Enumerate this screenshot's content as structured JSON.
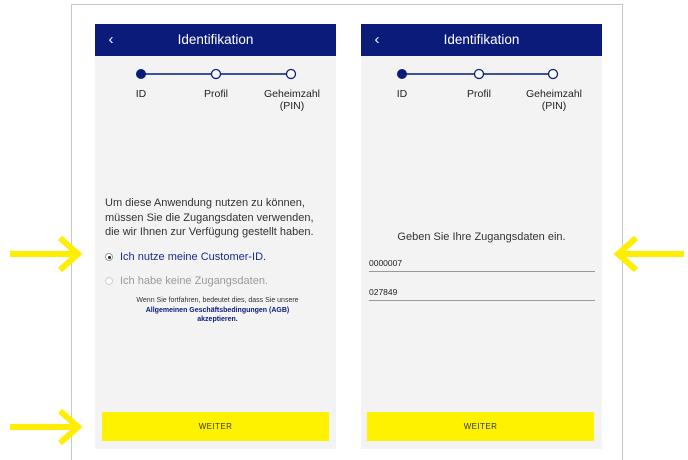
{
  "colors": {
    "nav_bg": "#0b1b7a",
    "screen_bg": "#f3f3f3",
    "cta_bg": "#fff200",
    "arrow": "#ffee00",
    "link": "#0b1b7a"
  },
  "left_screen": {
    "nav": {
      "back_glyph": "‹",
      "title": "Identifikation"
    },
    "stepper": {
      "steps": [
        {
          "label": "ID",
          "state": "active"
        },
        {
          "label": "Profil",
          "state": "pending"
        },
        {
          "label_line1": "Geheimzahl",
          "label_line2": "(PIN)",
          "state": "pending"
        }
      ]
    },
    "intro_text": "Um diese Anwendung nutzen zu können, müssen Sie die Zugangsdaten verwenden, die wir Ihnen zur Verfügung gestellt haben.",
    "options": [
      {
        "label": "Ich nutze meine Customer-ID.",
        "selected": true
      },
      {
        "label": "Ich habe keine Zugangsdaten.",
        "selected": false
      }
    ],
    "agb": {
      "prefix": "Wenn Sie fortfahren, bedeutet dies, dass Sie unsere",
      "link": "Allgemeinen Geschäftsbedingungen (AGB)",
      "suffix": "akzeptieren."
    },
    "cta_label": "WEITER"
  },
  "right_screen": {
    "nav": {
      "back_glyph": "‹",
      "title": "Identifikation"
    },
    "stepper": {
      "steps": [
        {
          "label": "ID",
          "state": "active"
        },
        {
          "label": "Profil",
          "state": "pending"
        },
        {
          "label_line1": "Geheimzahl",
          "label_line2": "(PIN)",
          "state": "pending"
        }
      ]
    },
    "prompt": "Geben Sie Ihre Zugangsdaten ein.",
    "fields": [
      {
        "value": "0000007"
      },
      {
        "value": "027849"
      }
    ],
    "cta_label": "WEITER"
  },
  "annotations": [
    {
      "icon": "arrow-right-icon",
      "target": "option-customer-id"
    },
    {
      "icon": "arrow-right-icon",
      "target": "weiter-button"
    },
    {
      "icon": "arrow-left-icon",
      "target": "credentials-form"
    }
  ]
}
